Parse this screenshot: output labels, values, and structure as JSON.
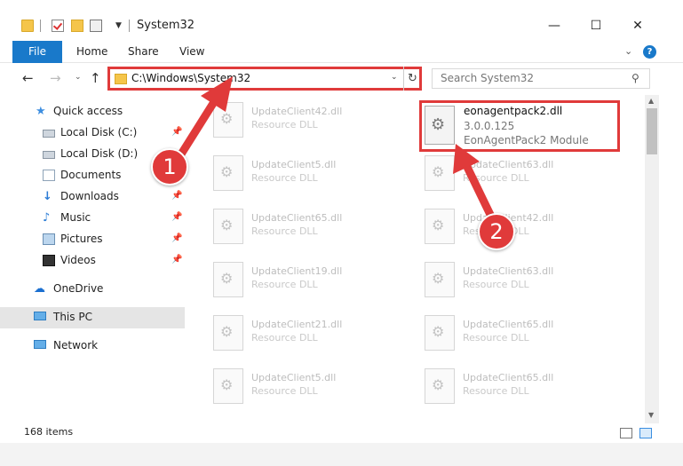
{
  "window": {
    "title": "System32",
    "minimize": "—",
    "maximize": "☐",
    "close": "✕"
  },
  "ribbon": {
    "file": "File",
    "home": "Home",
    "share": "Share",
    "view": "View",
    "help": "?"
  },
  "address": {
    "path": "C:\\Windows\\System32"
  },
  "search": {
    "placeholder": "Search System32"
  },
  "navpane": {
    "items": [
      {
        "label": "Quick access",
        "icon": "star-icon"
      },
      {
        "label": "Local Disk (C:)",
        "icon": "disk-icon"
      },
      {
        "label": "Local Disk (D:)",
        "icon": "disk-icon"
      },
      {
        "label": "Documents",
        "icon": "documents-icon"
      },
      {
        "label": "Downloads",
        "icon": "downloads-icon"
      },
      {
        "label": "Music",
        "icon": "music-icon"
      },
      {
        "label": "Pictures",
        "icon": "pictures-icon"
      },
      {
        "label": "Videos",
        "icon": "videos-icon"
      },
      {
        "label": "OneDrive",
        "icon": "cloud-icon"
      },
      {
        "label": "This PC",
        "icon": "computer-icon"
      },
      {
        "label": "Network",
        "icon": "network-icon"
      }
    ]
  },
  "files": [
    {
      "name": "UpdateClient42.dll",
      "type": "Resource DLL"
    },
    {
      "name": "UpdateClient5.dll",
      "type": "Resource DLL"
    },
    {
      "name": "UpdateClient63.dll",
      "type": "Resource DLL"
    },
    {
      "name": "UpdateClient65.dll",
      "type": "Resource DLL"
    },
    {
      "name": "UpdateClient42.dll",
      "type": "Resource DLL"
    },
    {
      "name": "UpdateClient19.dll",
      "type": "Resource DLL"
    },
    {
      "name": "UpdateClient63.dll",
      "type": "Resource DLL"
    },
    {
      "name": "UpdateClient21.dll",
      "type": "Resource DLL"
    },
    {
      "name": "UpdateClient65.dll",
      "type": "Resource DLL"
    },
    {
      "name": "UpdateClient5.dll",
      "type": "Resource DLL"
    },
    {
      "name": "UpdateClient65.dll",
      "type": "Resource DLL"
    }
  ],
  "highlighted_file": {
    "name": "eonagentpack2.dll",
    "version": "3.0.0.125",
    "description": "EonAgentPack2 Module"
  },
  "status": {
    "item_count": "168 items"
  },
  "annotations": {
    "step1": "1",
    "step2": "2",
    "color": "#e03a3a"
  }
}
